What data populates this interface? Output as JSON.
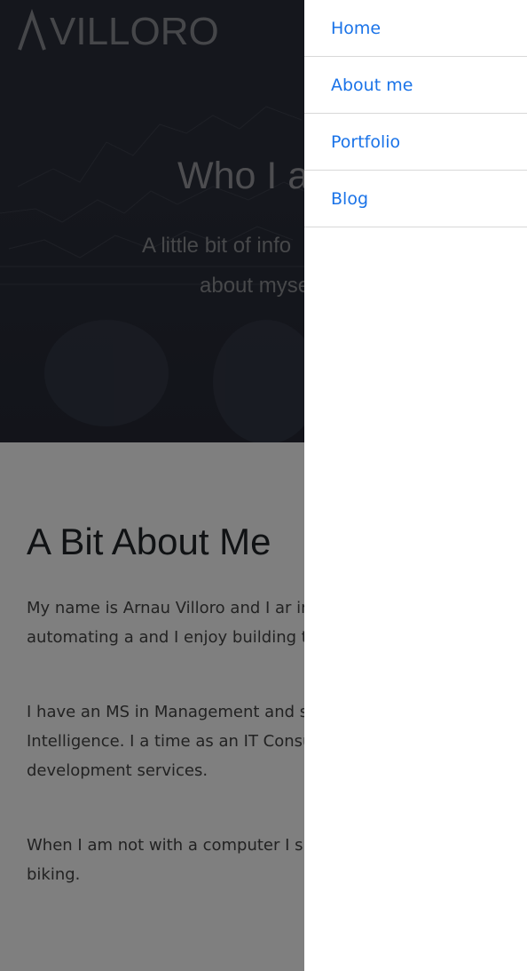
{
  "header": {
    "logo_text": "VILLORO"
  },
  "hero": {
    "title": "Who I a",
    "subtitle_line1": "A little bit of info",
    "subtitle_line2": "about myse"
  },
  "about": {
    "title": "A Bit About Me",
    "paragraph1": "My name is Arnau Villoro and I ar in Barcelona. I love automating a and I enjoy building things all by",
    "paragraph2": "I have an MS in Management and studying Artificial Intelligence. I a time as an IT Consultant offering development services.",
    "paragraph3": "When I am not with a computer I such as climbing and biking."
  },
  "nav": {
    "items": [
      {
        "label": "Home"
      },
      {
        "label": "About me"
      },
      {
        "label": "Portfolio"
      },
      {
        "label": "Blog"
      }
    ]
  },
  "colors": {
    "link": "#1a73e8",
    "hero_bg": "#2a2e3a"
  }
}
